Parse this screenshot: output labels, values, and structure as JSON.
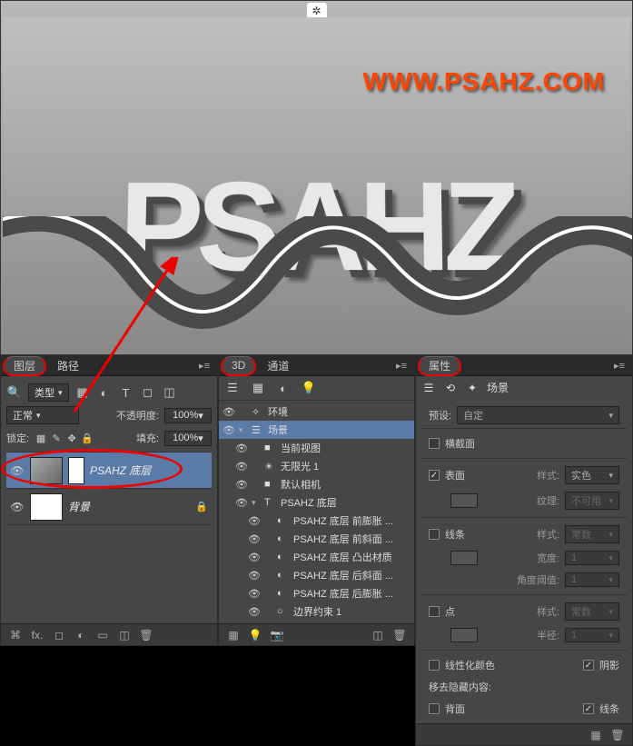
{
  "watermark": "WWW.PSAHZ.COM",
  "text3d": "PSAHZ",
  "layers_panel": {
    "tabs": {
      "layers": "图层",
      "paths": "路径"
    },
    "kind_label": "类型",
    "blend_mode": "正常",
    "opacity_label": "不透明度:",
    "opacity_value": "100%",
    "lock_label": "锁定:",
    "fill_label": "填充:",
    "fill_value": "100%",
    "layers": [
      {
        "name": "PSAHZ 底层",
        "selected": true
      },
      {
        "name": "背景",
        "selected": false
      }
    ]
  },
  "d3_panel": {
    "tabs": {
      "d3": "3D",
      "channels": "通道"
    },
    "tree": [
      {
        "label": "环境",
        "indent": 0,
        "chev": "",
        "icon": "✧"
      },
      {
        "label": "场景",
        "indent": 0,
        "chev": "▾",
        "icon": "☰",
        "selected": true
      },
      {
        "label": "当前视图",
        "indent": 1,
        "chev": "",
        "icon": "■"
      },
      {
        "label": "无限光 1",
        "indent": 1,
        "chev": "",
        "icon": "☀"
      },
      {
        "label": "默认相机",
        "indent": 1,
        "chev": "",
        "icon": "■"
      },
      {
        "label": "PSAHZ 底层",
        "indent": 1,
        "chev": "▾",
        "icon": "T"
      },
      {
        "label": "PSAHZ 底层 前膨胀 ...",
        "indent": 2,
        "chev": "",
        "icon": "◐"
      },
      {
        "label": "PSAHZ 底层 前斜面 ...",
        "indent": 2,
        "chev": "",
        "icon": "◐"
      },
      {
        "label": "PSAHZ 底层 凸出材质",
        "indent": 2,
        "chev": "",
        "icon": "◐"
      },
      {
        "label": "PSAHZ 底层 后斜面 ...",
        "indent": 2,
        "chev": "",
        "icon": "◐"
      },
      {
        "label": "PSAHZ 底层 后膨胀 ...",
        "indent": 2,
        "chev": "",
        "icon": "◐"
      },
      {
        "label": "边界约束 1",
        "indent": 2,
        "chev": "",
        "icon": "○"
      }
    ]
  },
  "props_panel": {
    "tabs": {
      "props": "属性"
    },
    "title": "场景",
    "preset_label": "预设:",
    "preset_value": "自定",
    "section_cross": "横截面",
    "section_surface": "表面",
    "surface_style_label": "样式:",
    "surface_style_value": "实色",
    "texture_label": "纹理:",
    "texture_value": "不可用",
    "section_lines": "线条",
    "lines_style_label": "样式:",
    "lines_style_value": "常数",
    "width_label": "宽度:",
    "width_value": "1",
    "angle_label": "角度阈值:",
    "angle_value": "1",
    "section_points": "点",
    "points_style_label": "样式:",
    "points_style_value": "常数",
    "radius_label": "半径:",
    "radius_value": "1",
    "linearize_label": "线性化颜色",
    "shadow_label": "阴影",
    "hide_label": "移去隐藏内容:",
    "backface_label": "背面",
    "lines2_label": "线条"
  }
}
